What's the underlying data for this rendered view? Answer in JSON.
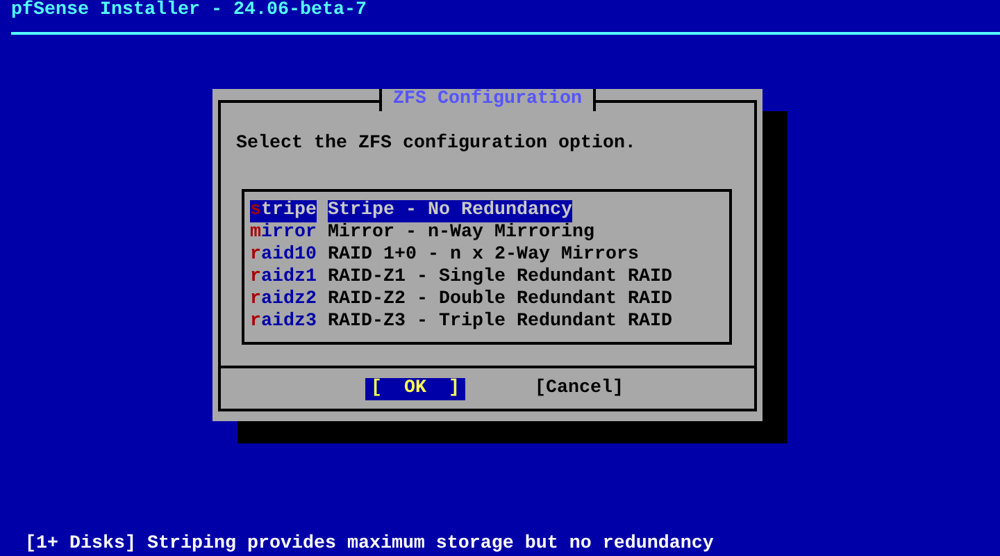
{
  "window": {
    "title": "pfSense Installer - 24.06-beta-7"
  },
  "dialog": {
    "title": "ZFS Configuration",
    "prompt": "Select the ZFS configuration option.",
    "options": [
      {
        "tag": "stripe",
        "description": "Stripe - No Redundancy",
        "selected": true
      },
      {
        "tag": "mirror",
        "description": "Mirror - n-Way Mirroring",
        "selected": false
      },
      {
        "tag": "raid10",
        "description": "RAID 1+0 - n x 2-Way Mirrors",
        "selected": false
      },
      {
        "tag": "raidz1",
        "description": "RAID-Z1 - Single Redundant RAID",
        "selected": false
      },
      {
        "tag": "raidz2",
        "description": "RAID-Z2 - Double Redundant RAID",
        "selected": false
      },
      {
        "tag": "raidz3",
        "description": "RAID-Z3 - Triple Redundant RAID",
        "selected": false
      }
    ],
    "buttons": [
      {
        "label": "[  OK  ]",
        "selected": true
      },
      {
        "label": "[Cancel]",
        "selected": false
      }
    ]
  },
  "status_bar": "[1+ Disks] Striping provides maximum storage but no redundancy"
}
